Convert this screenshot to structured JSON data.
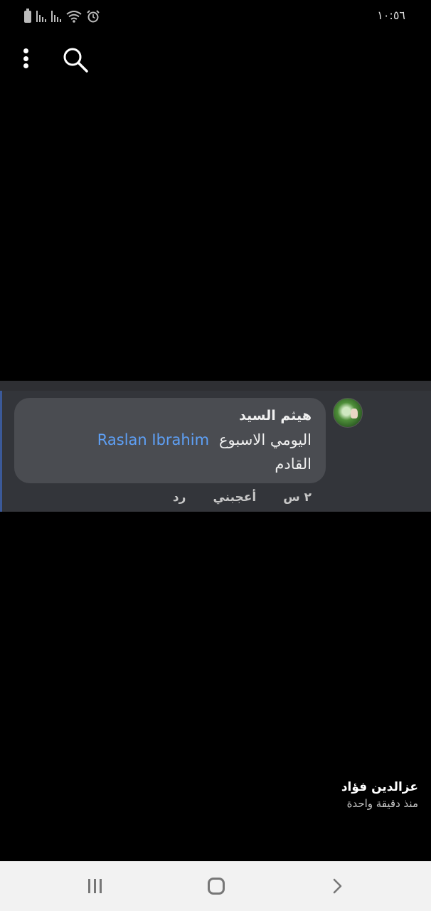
{
  "status_bar": {
    "time": "١٠:٥٦"
  },
  "comment": {
    "author": "هيثم السيد",
    "text": "اليومي الاسبوع",
    "text_line2": "القادم",
    "mention": "Raslan Ibrahim",
    "time_ago": "٢ س",
    "like_label": "أعجبني",
    "reply_label": "رد"
  },
  "notification": {
    "name": "عزالدين فؤاد",
    "time": "منذ دقيقة واحدة"
  },
  "icons": {
    "battery": "battery-icon",
    "signal": "signal-icon",
    "wifi": "wifi-icon",
    "alarm": "alarm-icon",
    "more": "more-vertical-icon",
    "search": "search-icon",
    "recents": "recents-icon",
    "home": "home-icon",
    "back": "back-icon"
  },
  "colors": {
    "background": "#000000",
    "comment_panel": "#33353a",
    "bubble": "#4a4c51",
    "mention": "#5ea0f6",
    "navbar": "#f2f2f2"
  }
}
